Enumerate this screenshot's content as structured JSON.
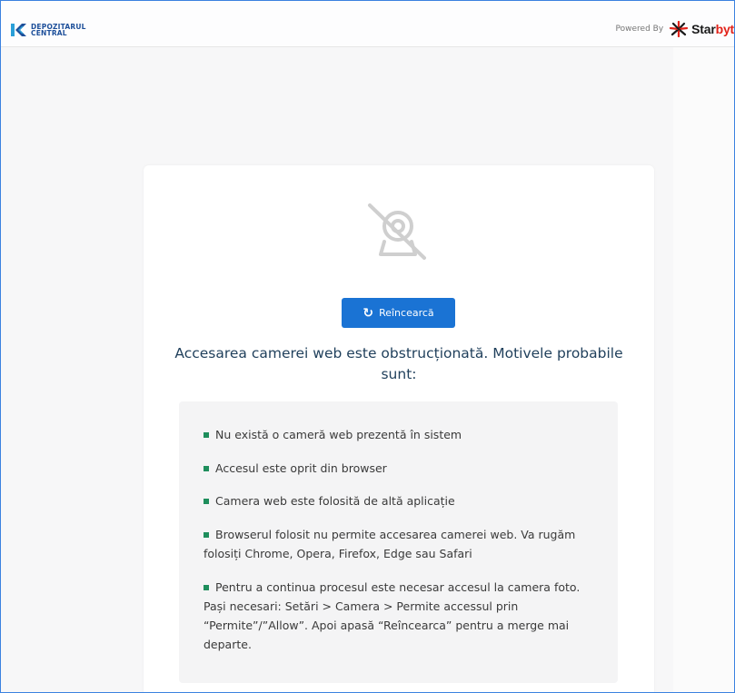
{
  "header": {
    "logo_line1": "DEPOZITARUL",
    "logo_line2": "CENTRAL",
    "powered_by": "Powered By",
    "brand_part1": "Star",
    "brand_part2": "byt"
  },
  "retry_label": "Reîncearcă",
  "error_heading": "Accesarea camerei web este obstrucționată. Motivele probabile sunt:",
  "reasons": [
    "Nu există o cameră web prezentă în sistem",
    "Accesul este oprit din browser",
    "Camera web este folosită de altă aplicație",
    "Browserul folosit nu permite accesarea camerei web. Va rugăm folosiți Chrome, Opera, Firefox, Edge sau Safari",
    "Pentru a continua procesul este necesar accesul la camera foto. Pași necesari: Setări > Camera > Permite accessul prin “Permite”/”Allow”. Apoi apasă “Reîncearca” pentru a merge mai departe."
  ],
  "colors": {
    "accent_blue": "#1a73d4",
    "heading": "#1f3f5b",
    "bullet_green": "#1e8e5c",
    "brand_red": "#e2231a",
    "logo_blue": "#1d4f9a"
  },
  "icons": {
    "logo": "depozitarul-central-logo",
    "brand": "starbyt-logo",
    "camera_blocked": "webcam-off-icon",
    "retry": "refresh-icon"
  }
}
